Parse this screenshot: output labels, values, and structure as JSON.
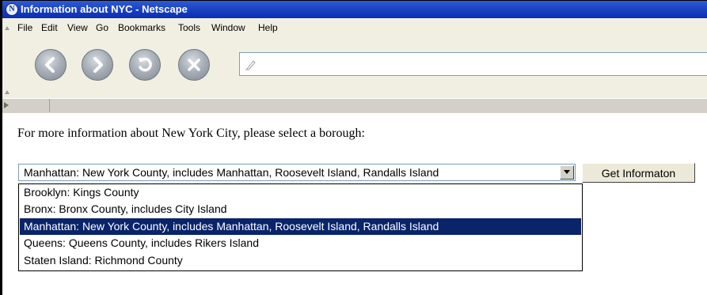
{
  "window": {
    "title": "Information about NYC - Netscape",
    "logo_letter": "N",
    "colors": {
      "titlebar": "#1c44c4",
      "chrome": "#f1efe2",
      "selection": "#0a246a"
    }
  },
  "menubar": {
    "items": [
      {
        "label": "File"
      },
      {
        "label": "Edit"
      },
      {
        "label": "View"
      },
      {
        "label": "Go"
      },
      {
        "label": "Bookmarks"
      },
      {
        "label": "Tools"
      },
      {
        "label": "Window"
      },
      {
        "label": "Help"
      }
    ]
  },
  "toolbar": {
    "buttons": [
      {
        "icon": "back-arrow-icon"
      },
      {
        "icon": "forward-arrow-icon"
      },
      {
        "icon": "reload-icon"
      },
      {
        "icon": "stop-icon"
      }
    ],
    "url_value": ""
  },
  "page": {
    "intro": "For more information about New York City, please select a borough:",
    "select": {
      "selected": "Manhattan: New York County, includes Manhattan, Roosevelt Island, Randalls Island",
      "options": [
        {
          "label": "Brooklyn: Kings County",
          "selected": false
        },
        {
          "label": "Bronx: Bronx County, includes City Island",
          "selected": false
        },
        {
          "label": "Manhattan: New York County, includes Manhattan, Roosevelt Island, Randalls Island",
          "selected": true
        },
        {
          "label": "Queens: Queens County, includes Rikers Island",
          "selected": false
        },
        {
          "label": "Staten Island: Richmond County",
          "selected": false
        }
      ]
    },
    "button_label": "Get Informaton"
  }
}
